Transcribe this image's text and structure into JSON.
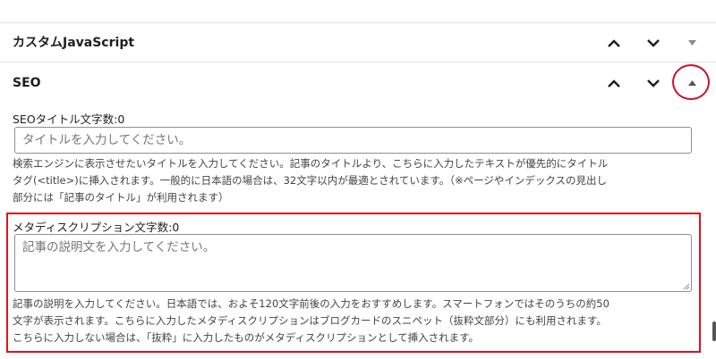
{
  "panels": {
    "custom_js": {
      "title": "カスタムJavaScript"
    },
    "seo": {
      "title": "SEO"
    }
  },
  "seo_title": {
    "label": "SEOタイトル文字数:0",
    "placeholder": "タイトルを入力してください。",
    "help_lines": [
      "検索エンジンに表示させたいタイトルを入力してください。記事のタイトルより、こちらに入力したテキストが優先的にタイトル",
      "タグ(<title>)に挿入されます。一般的に日本語の場合は、32文字以内が最適とされています。（※ページやインデックスの見出し",
      "部分には「記事のタイトル」が利用されます）"
    ]
  },
  "meta_description": {
    "label": "メタディスクリプション文字数:0",
    "placeholder": "記事の説明文を入力してください。",
    "help_lines": [
      "記事の説明を入力してください。日本語では、およそ120文字前後の入力をおすすめします。スマートフォンではそのうちの約50",
      "文字が表示されます。こちらに入力したメタディスクリプションはブログカードのスニペット（抜粋文部分）にも利用されます。",
      "こちらに入力しない場合は、「抜粋」に入力したものがメタディスクリプションとして挿入されます。"
    ]
  },
  "icons": {
    "move_up": "chevron-up-icon",
    "move_down": "chevron-down-icon",
    "collapse": "triangle-down-icon",
    "expand": "triangle-up-icon"
  },
  "colors": {
    "highlight_red": "#d6161f",
    "circle_red": "#c8102e",
    "input_border": "#8c8f94",
    "placeholder_gray": "#757575"
  }
}
